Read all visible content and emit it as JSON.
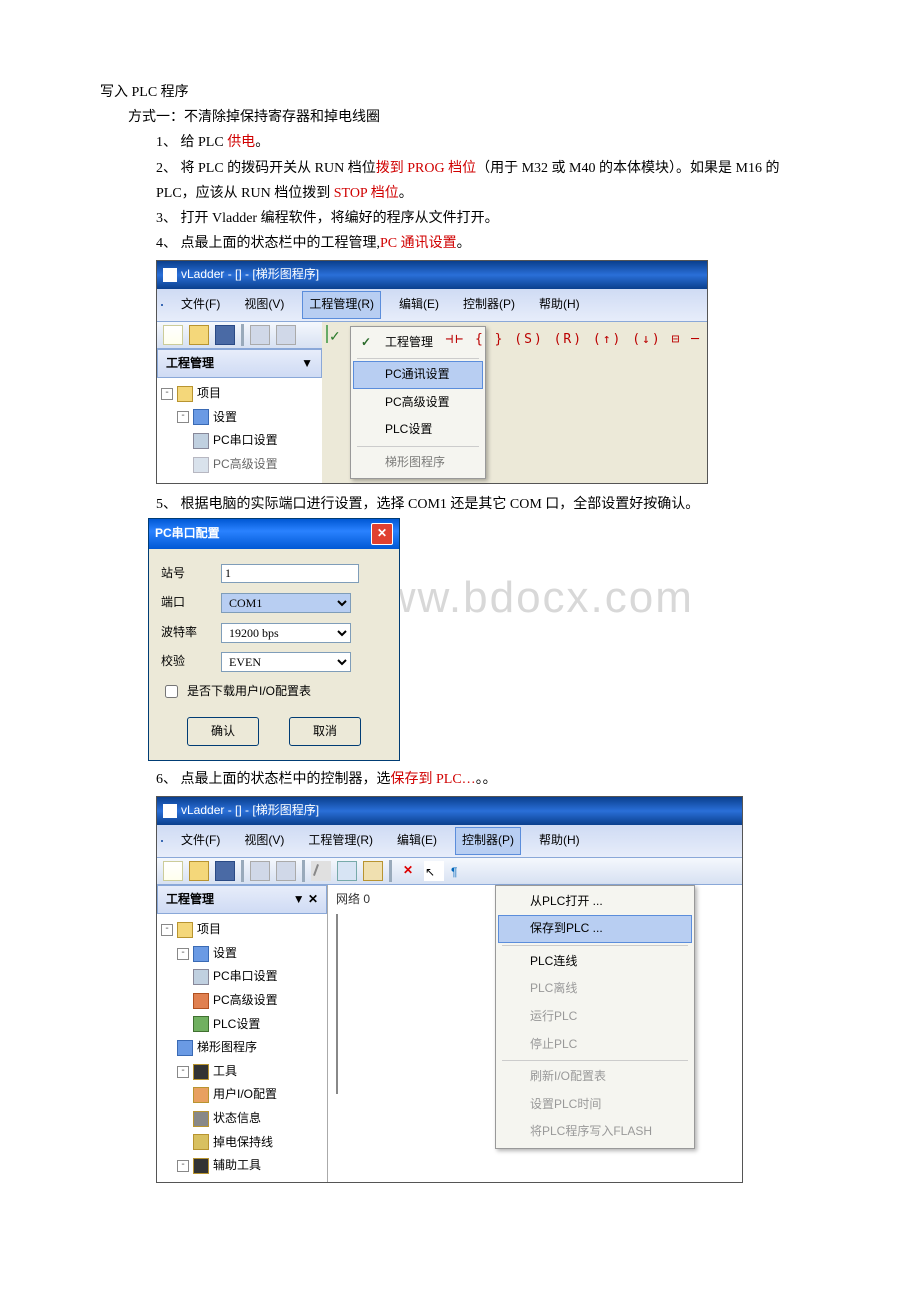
{
  "title": "写入 PLC 程序",
  "method1": {
    "heading": "方式一：不清除掉保持寄存器和掉电线圈",
    "step1_a": "1、 给 PLC ",
    "step1_b": "供电",
    "step1_c": "。",
    "step2_a": "2、 将 PLC 的拨码开关从 RUN 档位",
    "step2_b": "拨到 PROG 档位",
    "step2_c": "（用于 M32 或 M40 的本体模块）。如果是 M16 的 PLC，应该从 RUN 档位拨到 ",
    "step2_d": "STOP 档位",
    "step2_e": "。",
    "step3": "3、 打开 Vladder 编程软件，将编好的程序从文件打开。",
    "step4_a": "4、 点最上面的状态栏中的工程管理,",
    "step4_b": "PC 通讯设置",
    "step4_c": "。",
    "step5": "5、 根据电脑的实际端口进行设置，选择 COM1 还是其它 COM 口，全部设置好按确认。",
    "step6_a": "6、 点最上面的状态栏中的控制器，选",
    "step6_b": "保存到 PLC…",
    "step6_c": "。。"
  },
  "app": {
    "title": "vLadder - [] - [梯形图程序]",
    "menu": {
      "file": "文件(F)",
      "view": "视图(V)",
      "project": "工程管理(R)",
      "edit": "编辑(E)",
      "controller": "控制器(P)",
      "help": "帮助(H)"
    },
    "panel_title": "工程管理",
    "tree": {
      "project": "项目",
      "settings": "设置",
      "pc_serial": "PC串口设置",
      "pc_advanced": "PC高级设置",
      "plc_settings": "PLC设置",
      "ladder": "梯形图程序",
      "tools": "工具",
      "user_io": "用户I/O配置",
      "status": "状态信息",
      "retain": "掉电保持线",
      "aux_tools": "辅助工具"
    },
    "proj_menu": {
      "proj_mgmt": "工程管理",
      "pc_comm": "PC通讯设置",
      "pc_adv": "PC高级设置",
      "plc_set": "PLC设置",
      "ladder_prog": "梯形图程序"
    },
    "ctrl_menu": {
      "open_from_plc": "从PLC打开 ...",
      "save_to_plc": "保存到PLC ...",
      "plc_connect": "PLC连线",
      "plc_offline": "PLC离线",
      "run_plc": "运行PLC",
      "stop_plc": "停止PLC",
      "refresh_io": "刷新I/O配置表",
      "set_plc_time": "设置PLC时间",
      "write_flash": "将PLC程序写入FLASH"
    },
    "network0": "网络 0"
  },
  "dialog": {
    "title": "PC串口配置",
    "station": "站号",
    "station_val": "1",
    "port": "端口",
    "port_val": "COM1",
    "baud": "波特率",
    "baud_val": "19200 bps",
    "parity": "校验",
    "parity_val": "EVEN",
    "chk_label": "是否下载用户I/O配置表",
    "ok": "确认",
    "cancel": "取消"
  },
  "watermark": "www.bdocx.com",
  "ladder_symbols": "⊣⊢ { } (S) (R) (↑) (↓) ⊟ ─"
}
